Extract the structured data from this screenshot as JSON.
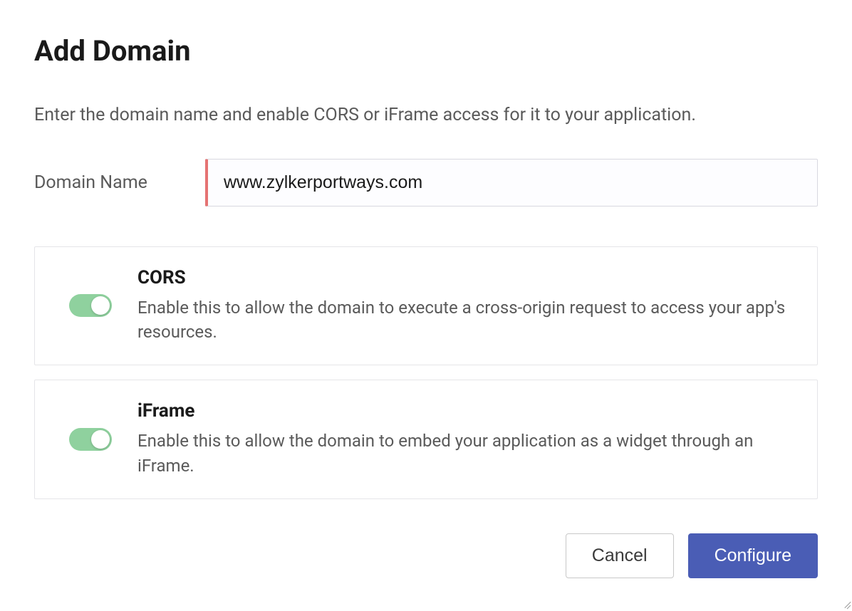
{
  "header": {
    "title": "Add Domain",
    "description": "Enter the domain name and enable CORS or iFrame access for it to your application."
  },
  "form": {
    "domain_name_label": "Domain Name",
    "domain_name_value": "www.zylkerportways.com"
  },
  "options": [
    {
      "title": "CORS",
      "description": "Enable this to allow the domain to execute a cross-origin request to access your app's resources.",
      "enabled": true
    },
    {
      "title": "iFrame",
      "description": "Enable this to allow the domain to embed your application as a widget through an iFrame.",
      "enabled": true
    }
  ],
  "buttons": {
    "cancel_label": "Cancel",
    "configure_label": "Configure"
  }
}
